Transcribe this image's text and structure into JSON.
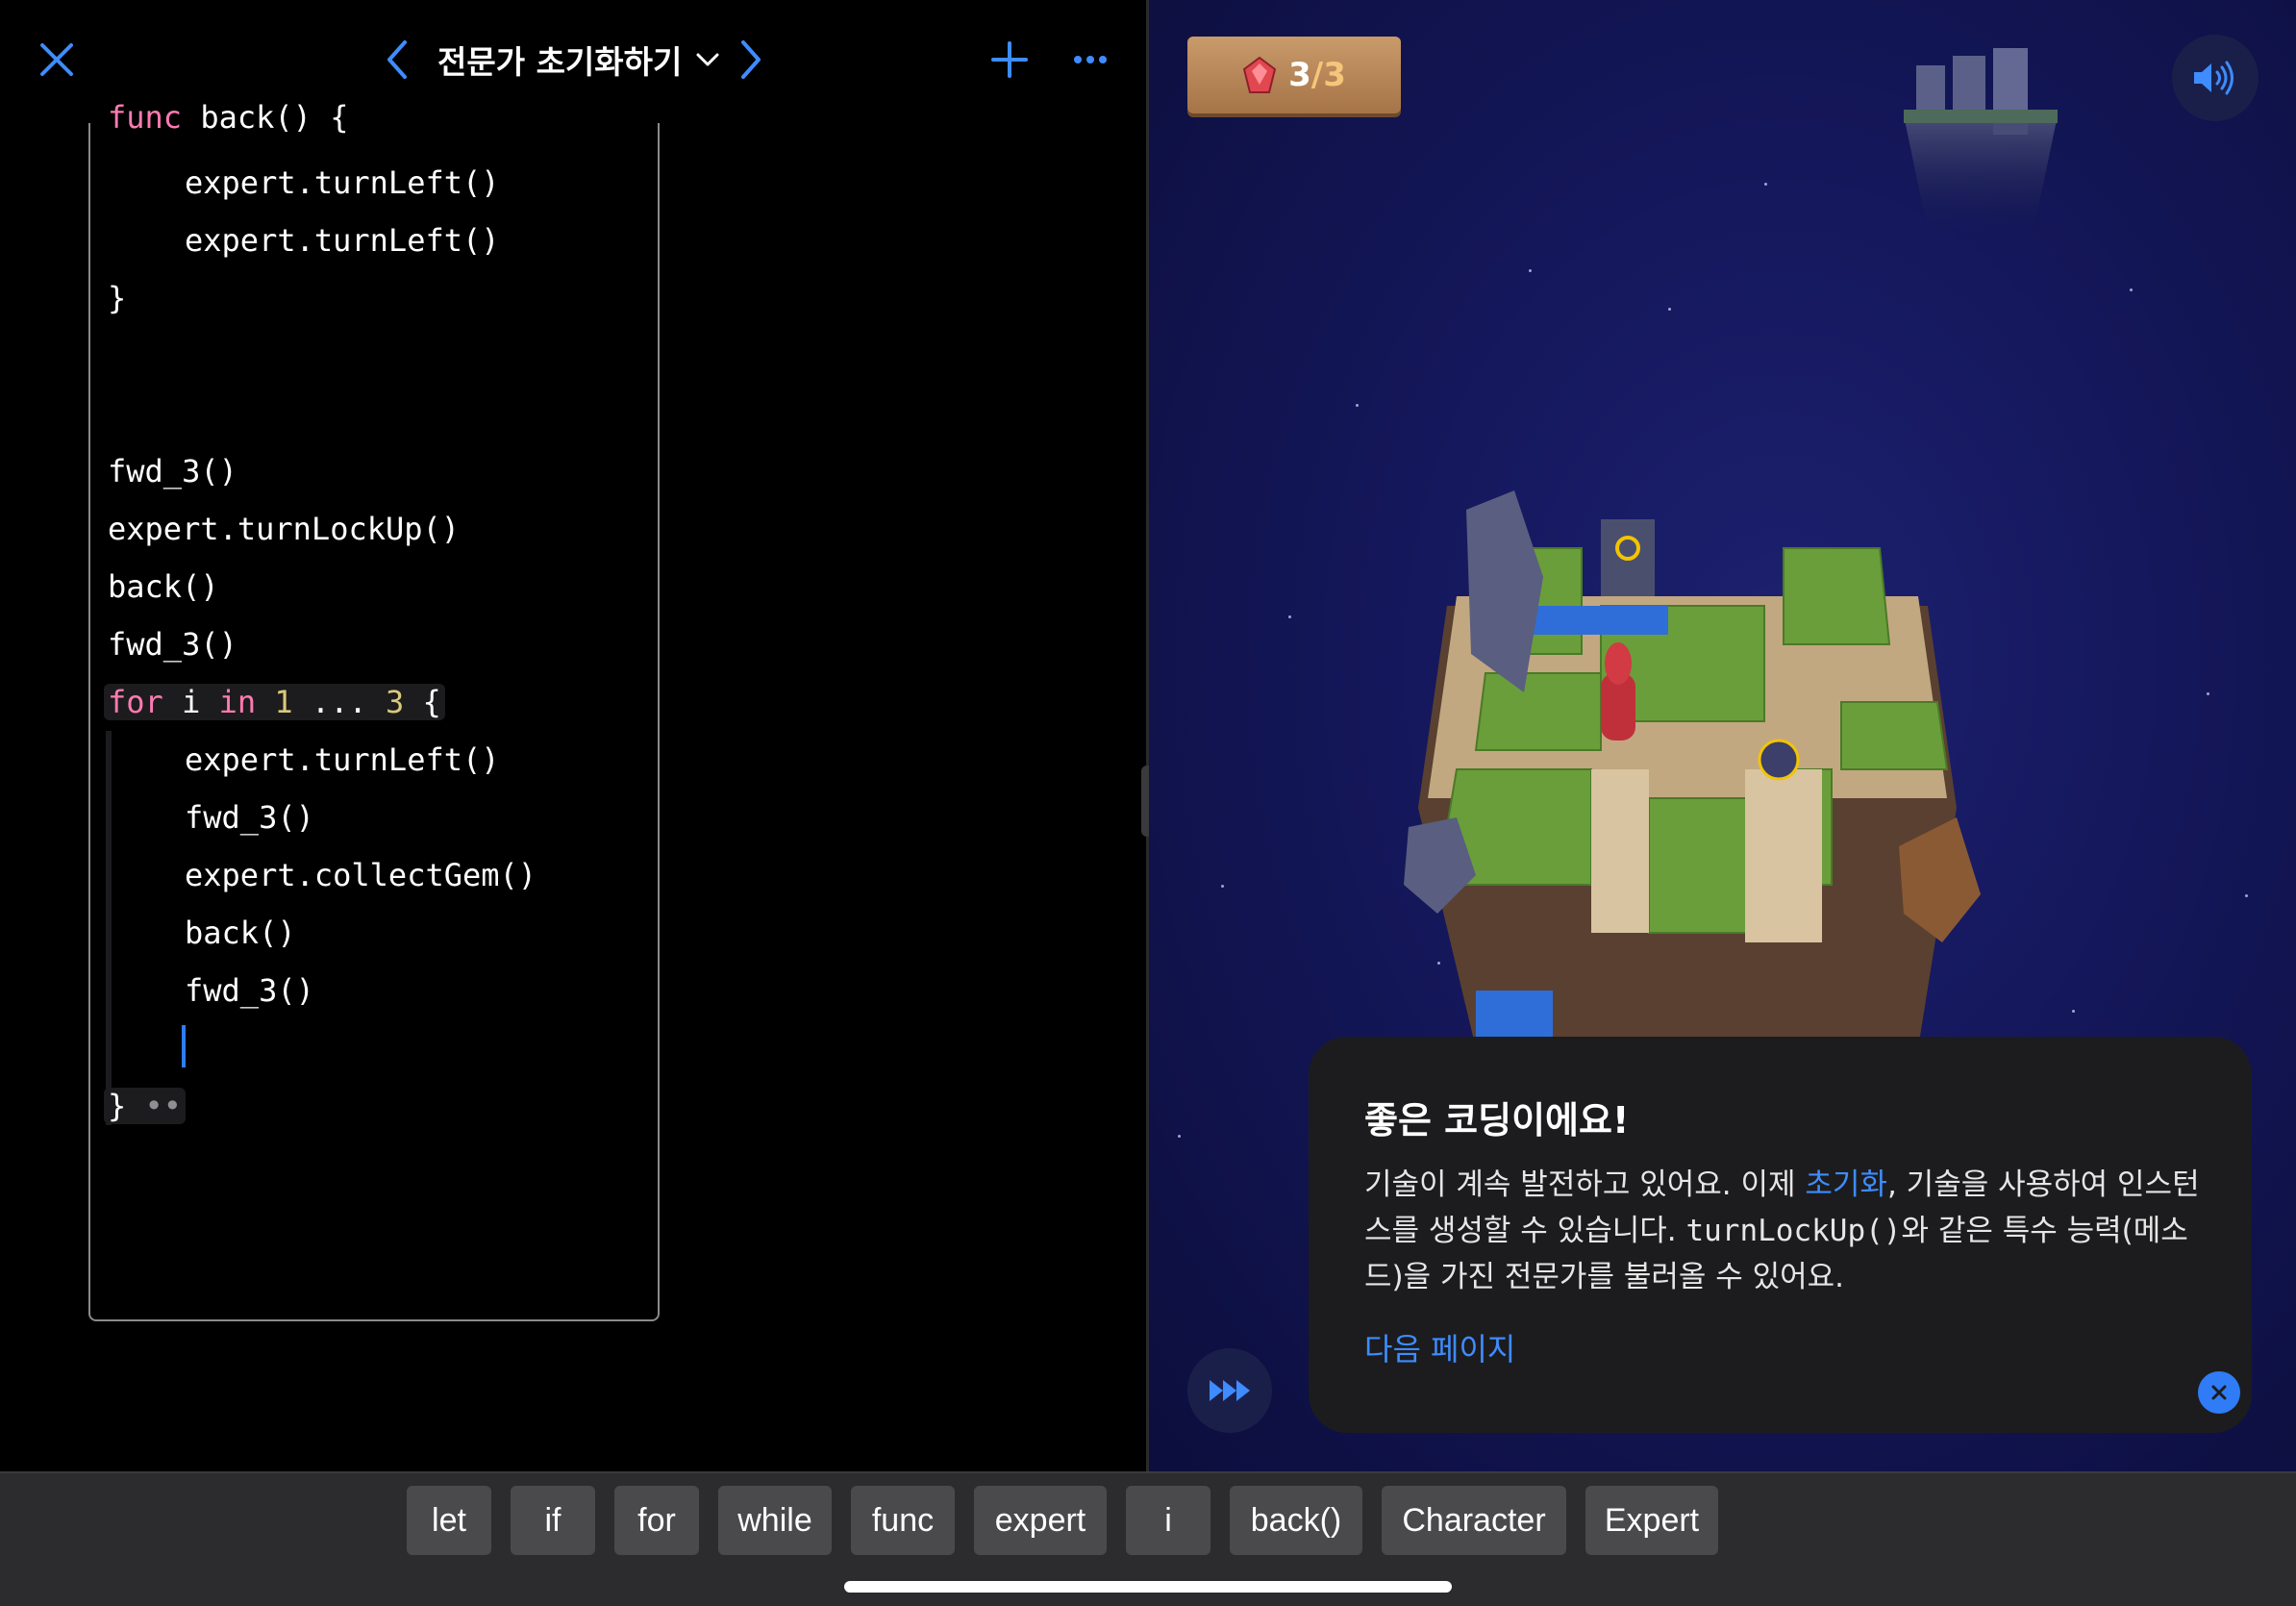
{
  "toolbar": {
    "title": "전문가 초기화하기"
  },
  "code": {
    "lines": [
      "func back() {",
      "expert.turnLeft()",
      "expert.turnLeft()",
      "}",
      "fwd_3()",
      "expert.turnLockUp()",
      "back()",
      "fwd_3()",
      "expert.turnLeft()",
      "fwd_3()",
      "expert.collectGem()",
      "back()",
      "fwd_3()",
      "}"
    ],
    "for_loop": {
      "keyword_for": "for",
      "var": "i",
      "keyword_in": "in",
      "start": "1",
      "op": "...",
      "end": "3",
      "brace": "{"
    },
    "fold_marker": "••"
  },
  "scene": {
    "gem_count": "3",
    "gem_total": "/3"
  },
  "hint": {
    "title": "좋은 코딩이에요!",
    "body_part1": "기술이 계속 발전하고 있어요. 이제 ",
    "body_highlight": "초기화",
    "body_part2": ", 기술을 사용하여 인스턴스를 생성할 수 있습니다. ",
    "body_code": "turnLockUp()",
    "body_part3": "와 같은 특수 능력(메소드)을 가진 전문가를 불러올 수 있어요.",
    "next_link": "다음 페이지"
  },
  "shortcuts": [
    "let",
    "if",
    "for",
    "while",
    "func",
    "expert",
    "i",
    "back()",
    "Character",
    "Expert"
  ],
  "colors": {
    "accent": "#2f7cf6",
    "keyword": "#ff7ab2",
    "number": "#d9c97c"
  }
}
